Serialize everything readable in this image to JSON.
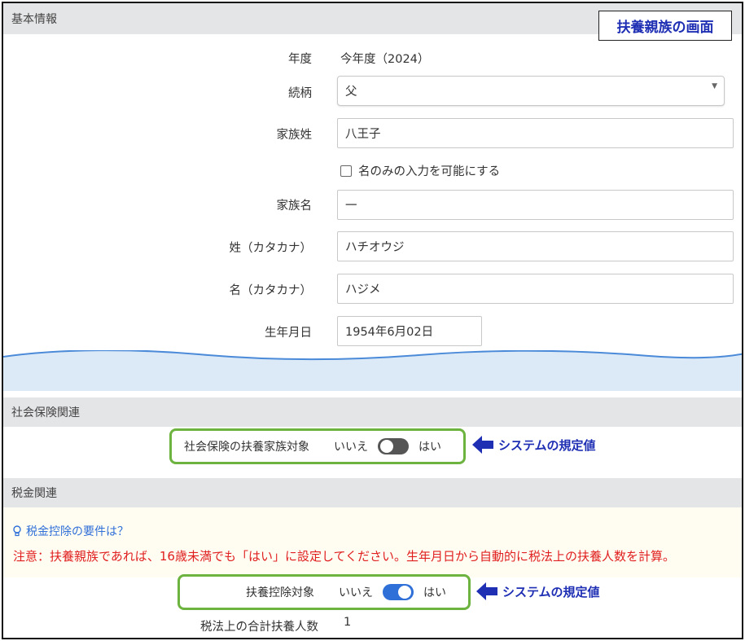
{
  "annotation_title": "扶養親族の画面",
  "basic": {
    "section_title": "基本情報",
    "year_label": "年度",
    "year_value": "今年度（2024）",
    "relation_label": "続柄",
    "relation_value": "父",
    "family_last_label": "家族姓",
    "family_last_value": "八王子",
    "name_only_checkbox_label": "名のみの入力を可能にする",
    "family_first_label": "家族名",
    "family_first_value": "一",
    "last_kana_label": "姓（カタカナ）",
    "last_kana_value": "ハチオウジ",
    "first_kana_label": "名（カタカナ）",
    "first_kana_value": "ハジメ",
    "birthdate_label": "生年月日",
    "birthdate_value": "1954年6月02日"
  },
  "social": {
    "section_title": "社会保険関連",
    "dependent_label": "社会保険の扶養家族対象",
    "no_label": "いいえ",
    "yes_label": "はい",
    "toggle_on": false,
    "annotation": "システムの規定値"
  },
  "tax": {
    "section_title": "税金関連",
    "requirements_link": "税金控除の要件は？",
    "notice": "注意：扶養親族であれば、16歳未満でも「はい」に設定してください。生年月日から自動的に税法上の扶養人数を計算。",
    "deduction_label": "扶養控除対象",
    "no_label": "いいえ",
    "yes_label": "はい",
    "toggle_on": true,
    "annotation": "システムの規定値",
    "total_dependents_label": "税法上の合計扶養人数",
    "total_dependents_value": "1"
  },
  "colors": {
    "annotation_blue": "#1f2fb4",
    "highlight_green": "#6db33f",
    "toggle_on": "#2f6fd8",
    "toggle_off": "#555555",
    "notice_red": "#e02020",
    "section_bg": "#e4e5e7"
  }
}
